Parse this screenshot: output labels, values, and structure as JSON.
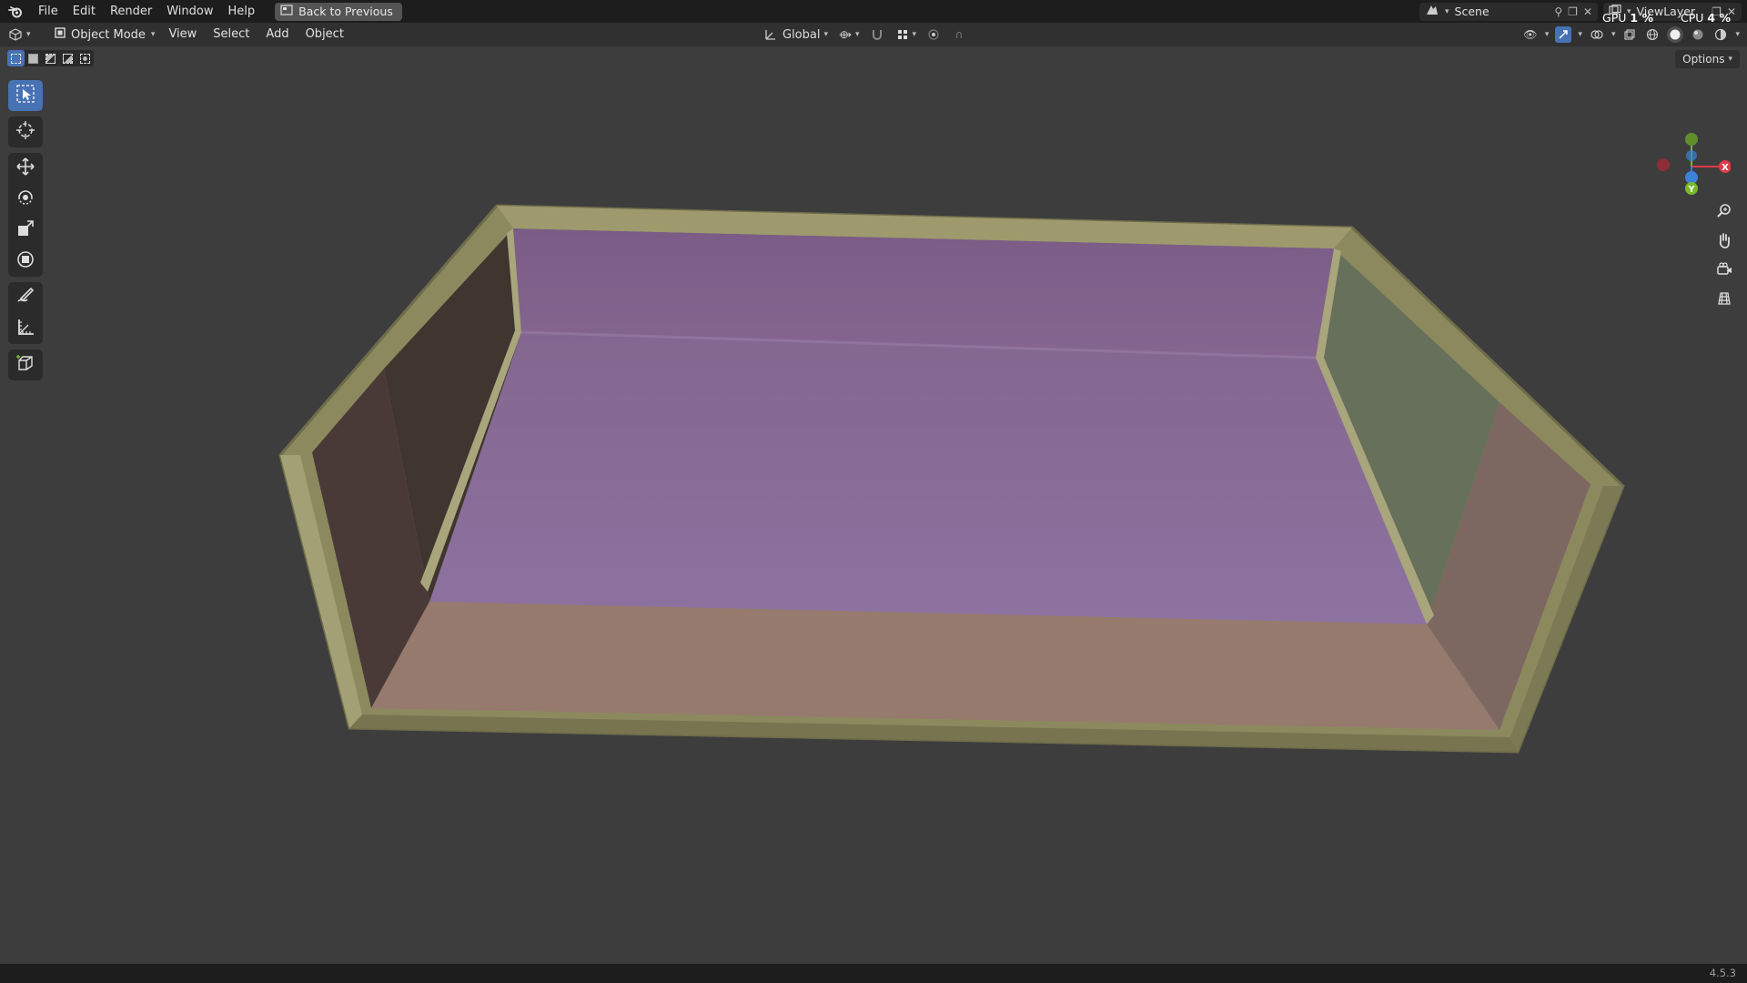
{
  "menubar": {
    "items": [
      "File",
      "Edit",
      "Render",
      "Window",
      "Help"
    ],
    "back_button": "Back to Previous",
    "scene": "Scene",
    "view_layer": "ViewLayer",
    "gpu_label": "GPU",
    "gpu_value": "1 %",
    "cpu_label": "CPU",
    "cpu_value": "4 %"
  },
  "header": {
    "mode": "Object Mode",
    "menus": [
      "View",
      "Select",
      "Add",
      "Object"
    ],
    "transform_orientation": "Global"
  },
  "options_label": "Options",
  "toolbar": {
    "tools": [
      "select-box",
      "cursor",
      "move",
      "rotate",
      "scale",
      "transform",
      "annotate",
      "measure",
      "add-cube"
    ],
    "active": "select-box"
  },
  "gizmo": {
    "axes": [
      "X",
      "Y",
      "Z"
    ],
    "colors": {
      "x": "#e0394a",
      "y": "#7ab82c",
      "z": "#3b82d8"
    }
  },
  "viewport_colors": {
    "background": "#3d3d3d",
    "rim": "#8e8b62",
    "floor": "#8b6f9a",
    "back_wall": "#7a5f86",
    "front_wall": "#967a6d",
    "left_wall": "#3f342f",
    "right_wall": "#66705a"
  },
  "version": "4.5.3"
}
